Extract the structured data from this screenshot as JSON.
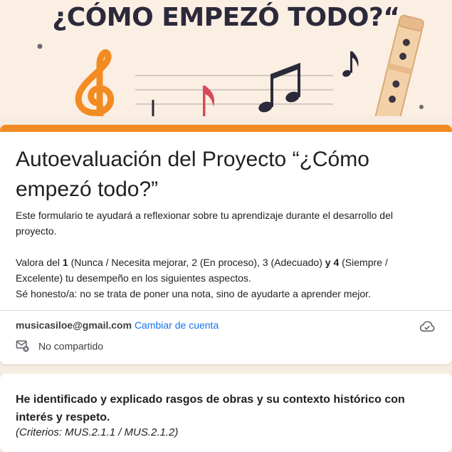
{
  "banner": {
    "title": "¿CÓMO EMPEZÓ TODO?“",
    "colors": {
      "background": "#fbeee2",
      "title": "#2b2a3b",
      "clef": "#f28b22",
      "notes": "#2b2a3b",
      "note_red": "#d94b5b"
    }
  },
  "theme": {
    "accent": "#f28b22",
    "page_background": "#f7ece2",
    "link": "#1a73e8"
  },
  "form": {
    "title": "Autoevaluación del Proyecto “¿Cómo empezó todo?”",
    "description_line1": "Este formulario te ayudará a reflexionar sobre tu aprendizaje durante el desarrollo del proyecto.",
    "rating": {
      "prefix": "Valora del ",
      "min": "1",
      "min_text": " (Nunca / Necesita mejorar, 2 (En proceso), 3 (Adecuado) ",
      "y": "y",
      "space": " ",
      "max": "4",
      "max_text": " (Siempre / Excelente) tu desempeño en los siguientes aspectos."
    },
    "honesty_line": "Sé honesto/a: no se trata de poner una nota, sino de ayudarte a aprender mejor."
  },
  "account": {
    "email": "musicasiloe@gmail.com",
    "switch_label": "Cambiar de cuenta",
    "share_status": "No compartido",
    "icons": {
      "cloud": "cloud-check-icon",
      "share": "mail-not-shared-icon"
    }
  },
  "question": {
    "title": "He identificado y explicado rasgos de obras y su contexto histórico con interés y respeto.",
    "criteria": "(Criterios: MUS.2.1.1 / MUS.2.1.2)"
  }
}
